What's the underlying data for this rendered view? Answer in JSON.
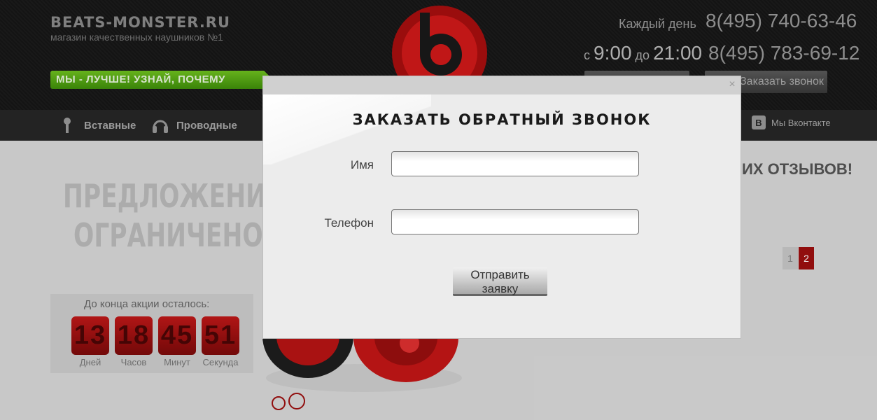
{
  "header": {
    "site_name": "BEATS-MONSTER.RU",
    "tagline": "магазин качественных наушников №1",
    "promo_banner": "МЫ - ЛУЧШЕ! УЗНАЙ, ПОЧЕМУ",
    "schedule_label": "Каждый день",
    "hours_from_prefix": "с",
    "hours_from": "9:00",
    "hours_to_prefix": "до",
    "hours_to": "21:00",
    "phone_1": "8(495) 740-63-46",
    "phone_2": "8(495) 783-69-12",
    "callback_button": "Заказать звонок"
  },
  "nav": {
    "items": [
      {
        "label": "Вставные",
        "icon": "earbud-icon"
      },
      {
        "label": "Проводные",
        "icon": "headphones-icon"
      }
    ],
    "vk_label": "Мы Вконтакте",
    "vk_letter": "B"
  },
  "main": {
    "offer_heading_line1": "ПРЕДЛОЖЕНИЕ",
    "offer_heading_line2": "ОГРАНИЧЕНО",
    "reviews_heading": "ИХ ОТЗЫВОВ!",
    "pagination": [
      "1",
      "2"
    ],
    "timer": {
      "title": "До конца акции осталось:",
      "units": [
        {
          "value": "13",
          "label": "Дней"
        },
        {
          "value": "18",
          "label": "Часов"
        },
        {
          "value": "45",
          "label": "Минут"
        },
        {
          "value": "51",
          "label": "Секунда"
        }
      ]
    }
  },
  "modal": {
    "title": "ЗАКАЗАТЬ ОБРАТНЫЙ ЗВОНОК",
    "close_glyph": "×",
    "name_label": "Имя",
    "name_value": "",
    "phone_label": "Телефон",
    "phone_value": "",
    "submit_label": "Отправить заявку"
  },
  "colors": {
    "brand_red": "#c01818",
    "promo_green": "#5aad18",
    "header_dark": "#1c1c1c"
  }
}
